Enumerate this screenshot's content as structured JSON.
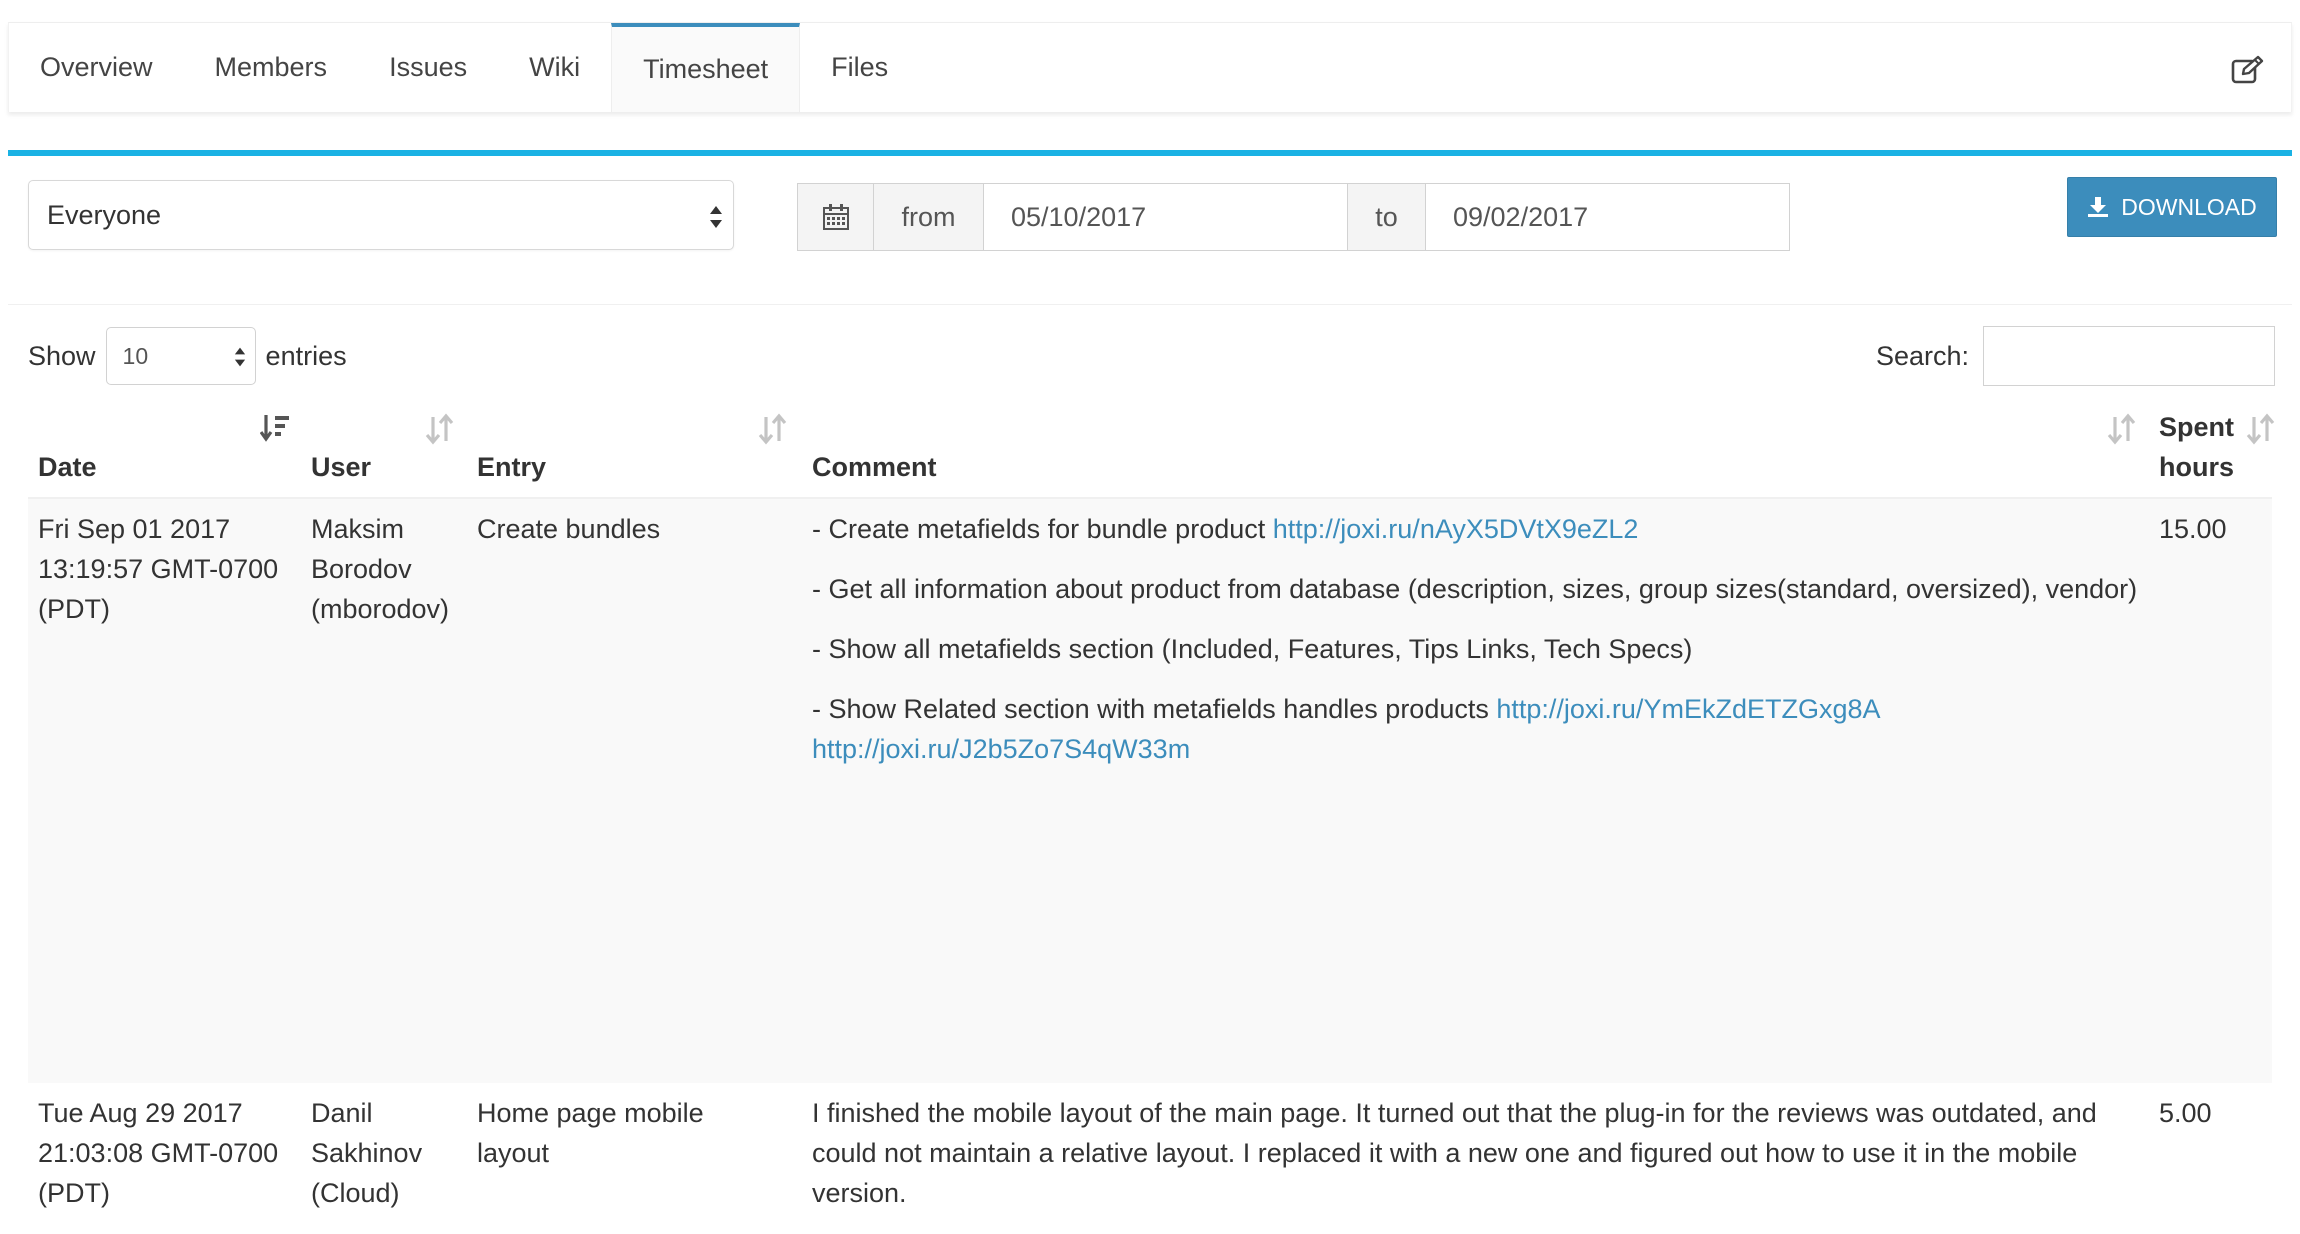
{
  "tabs": [
    {
      "label": "Overview"
    },
    {
      "label": "Members"
    },
    {
      "label": "Issues"
    },
    {
      "label": "Wiki"
    },
    {
      "label": "Timesheet",
      "active": true
    },
    {
      "label": "Files"
    }
  ],
  "filters": {
    "user_select": "Everyone",
    "from_label": "from",
    "from_date": "05/10/2017",
    "to_label": "to",
    "to_date": "09/02/2017",
    "download_label": "DOWNLOAD"
  },
  "table_controls": {
    "show_label": "Show",
    "page_length": "10",
    "entries_label": "entries",
    "search_label": "Search:",
    "search_value": ""
  },
  "columns": {
    "date": "Date",
    "user": "User",
    "entry": "Entry",
    "comment": "Comment",
    "spent_line1": "Spent",
    "spent_line2": "hours"
  },
  "rows": [
    {
      "date_line1": "Fri Sep 01 2017",
      "date_line2": "13:19:57 GMT-0700",
      "date_line3": "(PDT)",
      "user_line1": "Maksim",
      "user_line2": "Borodov",
      "user_line3": "(mborodov)",
      "entry": "Create bundles",
      "c1_text": "- Create metafields for bundle product ",
      "c1_link": "http://joxi.ru/nAyX5DVtX9eZL2",
      "c2_text": "- Get all information about product from database (description, sizes, group sizes(standard, oversized), vendor)",
      "c3_text": "- Show all metafields section (Included, Features, Tips Links, Tech Specs)",
      "c4_text": "- Show Related section with metafields handles products ",
      "c4_link1": "http://joxi.ru/YmEkZdETZGxg8A",
      "c4_link2": "http://joxi.ru/J2b5Zo7S4qW33m",
      "hours": "15.00"
    },
    {
      "date_line1": "Tue Aug 29 2017",
      "date_line2": "21:03:08 GMT-0700",
      "date_line3": "(PDT)",
      "user_line1": "Danil",
      "user_line2": "Sakhinov",
      "user_line3": "(Cloud)",
      "entry_line1": "Home page mobile",
      "entry_line2": "layout",
      "comment": "I finished the mobile layout of the main page. It turned out that the plug-in for the reviews was outdated, and could not maintain a relative layout. I replaced it with a new one and figured out how to use it in the mobile version.",
      "hours": "5.00"
    }
  ],
  "colors": {
    "accent": "#3c8dbc",
    "box_top": "#1ab2e4",
    "link": "#3c8dbc"
  },
  "icons": {
    "edit": "edit-icon",
    "calendar": "calendar-icon",
    "download": "download-icon",
    "sort": "sort-icon"
  }
}
